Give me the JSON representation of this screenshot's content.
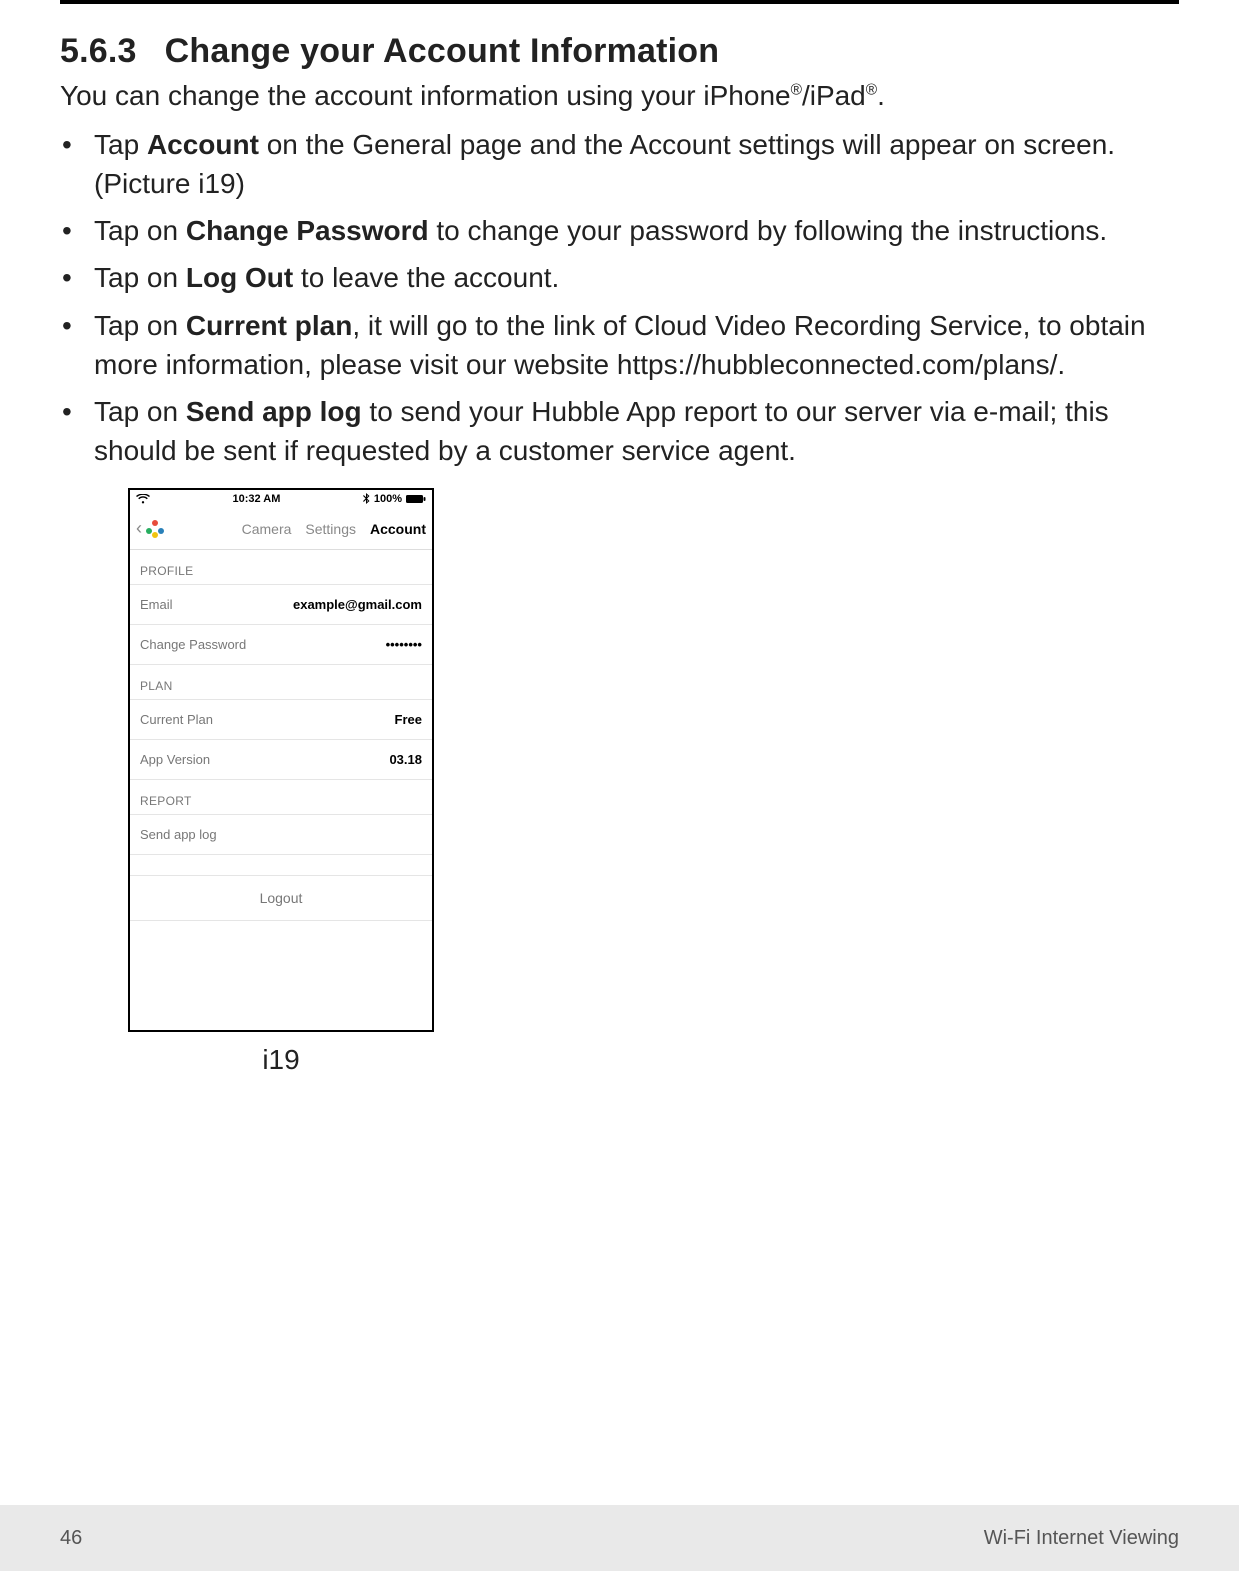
{
  "section": {
    "number": "5.6.3",
    "title": "Change your Account Information"
  },
  "intro": {
    "pre": "You can change the account information using your iPhone",
    "mid": "/iPad",
    "post": ".",
    "reg": "®"
  },
  "bullets": [
    {
      "pre": "Tap ",
      "bold": "Account",
      "post": " on the General page and the Account settings will appear on screen. (Picture i19)"
    },
    {
      "pre": "Tap on ",
      "bold": "Change Password",
      "post": " to change your password by following the instructions."
    },
    {
      "pre": "Tap on ",
      "bold": "Log Out",
      "post": " to leave the account."
    },
    {
      "pre": "Tap on ",
      "bold": "Current plan",
      "post": ", it will go to the link of Cloud Video Recording Service, to obtain more information, please visit our website https://hubbleconnected.com/plans/."
    },
    {
      "pre": "Tap on ",
      "bold": "Send app log",
      "post": " to send your Hubble App report to our server via e-mail; this should be sent if requested by a customer service agent."
    }
  ],
  "phone": {
    "status": {
      "time": "10:32 AM",
      "battery": "100%"
    },
    "tabs": {
      "camera": "Camera",
      "settings": "Settings",
      "account": "Account"
    },
    "groups": {
      "profile": {
        "header": "PROFILE",
        "email_label": "Email",
        "email_value": "example@gmail.com",
        "pw_label": "Change Password",
        "pw_value": "••••••••"
      },
      "plan": {
        "header": "PLAN",
        "plan_label": "Current Plan",
        "plan_value": "Free",
        "ver_label": "App Version",
        "ver_value": "03.18"
      },
      "report": {
        "header": "REPORT",
        "send_label": "Send app log"
      }
    },
    "logout": "Logout"
  },
  "figure_caption": "i19",
  "footer": {
    "page": "46",
    "title": "Wi-Fi Internet Viewing"
  }
}
